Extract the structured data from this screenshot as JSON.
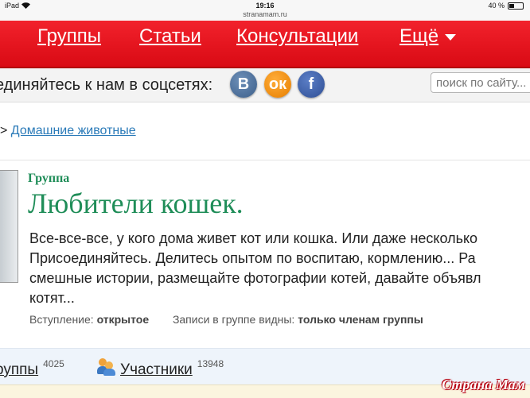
{
  "status_bar": {
    "device": "iPad",
    "wifi_icon": "wifi-icon",
    "time": "19:16",
    "url": "stranamam.ru",
    "battery": "40 %",
    "battery_level": 0.4
  },
  "nav": {
    "items": [
      {
        "label": "Группы"
      },
      {
        "label": "Статьи"
      },
      {
        "label": "Консультации"
      },
      {
        "label": "Ещё"
      }
    ],
    "bg_color": "#e8121c"
  },
  "social": {
    "text": "единяйтесь к нам в соцсетях:",
    "icons": [
      {
        "label": "В",
        "name": "vk-icon"
      },
      {
        "label": "ок",
        "name": "odnoklassniki-icon"
      },
      {
        "label": "f",
        "name": "facebook-icon"
      }
    ],
    "search_placeholder": "поиск по сайту..."
  },
  "breadcrumb": {
    "separator": ">",
    "link": "Домашние животные"
  },
  "group": {
    "label": "Группа",
    "title": "Любители кошек.",
    "description_lines": [
      "Все-все-все, у кого дома живет кот или кошка. Или даже несколько",
      "Присоединяйтесь. Делитесь опытом по воспитаю, кормлению... Ра",
      "смешные истории, размещайте фотографии котей, давайте объявл",
      "котят..."
    ],
    "entry_label": "Вступление:",
    "entry_value": "открытое",
    "visibility_label": "Записи в группе видны:",
    "visibility_value": "только членам группы",
    "title_color": "#1f8d58"
  },
  "tabs": [
    {
      "label": "руппы",
      "count": "4025"
    },
    {
      "label": "Участники",
      "count": "13948"
    }
  ],
  "watermark": "Страна Мам"
}
